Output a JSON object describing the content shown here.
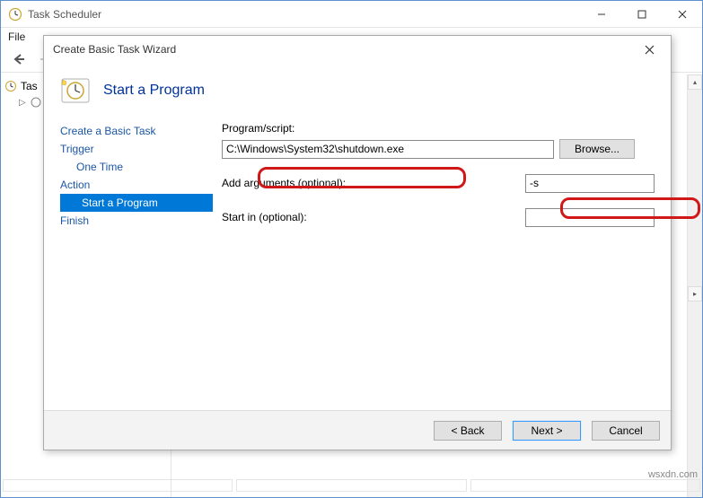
{
  "app": {
    "title": "Task Scheduler"
  },
  "menu": {
    "file": "File"
  },
  "tree": {
    "root": "Tas"
  },
  "dialog": {
    "title": "Create Basic Task Wizard",
    "heading": "Start a Program",
    "steps": {
      "create": "Create a Basic Task",
      "trigger": "Trigger",
      "onetime": "One Time",
      "action": "Action",
      "startprog": "Start a Program",
      "finish": "Finish"
    },
    "form": {
      "program_label": "Program/script:",
      "program_value": "C:\\Windows\\System32\\shutdown.exe",
      "browse": "Browse...",
      "args_label": "Add arguments (optional):",
      "args_value": "-s",
      "startin_label": "Start in (optional):",
      "startin_value": ""
    },
    "buttons": {
      "back": "< Back",
      "next": "Next >",
      "cancel": "Cancel"
    }
  },
  "watermark": "wsxdn.com"
}
